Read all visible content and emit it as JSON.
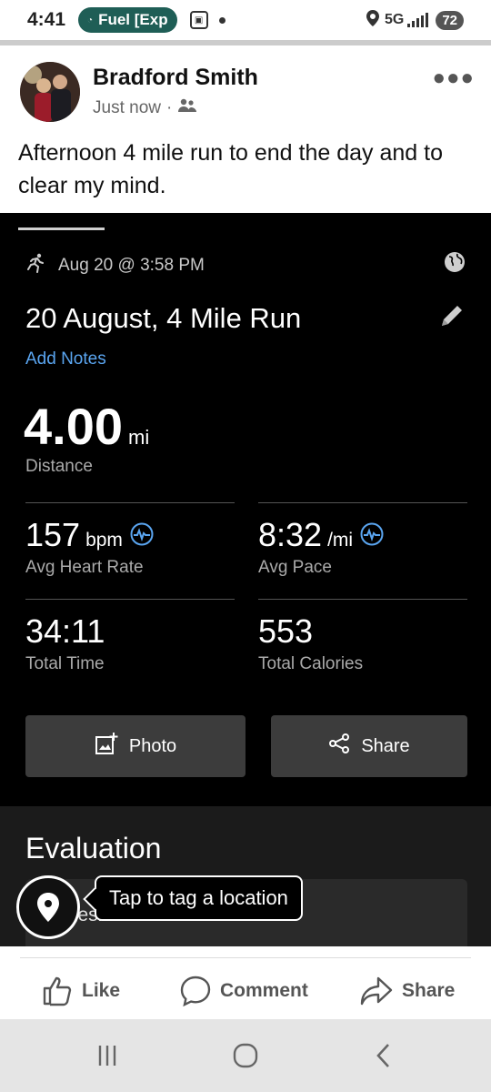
{
  "status_bar": {
    "time": "4:41",
    "pill_text": "Fuel [Exp",
    "network": "5G",
    "battery": "72"
  },
  "post": {
    "author": "Bradford Smith",
    "timestamp": "Just now",
    "text": "Afternoon 4 mile run to end the day and to clear my mind."
  },
  "activity": {
    "date": "Aug 20 @ 3:58 PM",
    "title": "20 August, 4 Mile Run",
    "add_notes": "Add Notes",
    "distance_value": "4.00",
    "distance_unit": "mi",
    "distance_label": "Distance",
    "stats": [
      {
        "value": "157",
        "unit": "bpm",
        "label": "Avg Heart Rate"
      },
      {
        "value": "8:32",
        "unit": "/mi",
        "label": "Avg Pace"
      },
      {
        "value": "34:11",
        "unit": "",
        "label": "Total Time"
      },
      {
        "value": "553",
        "unit": "",
        "label": "Total Calories"
      }
    ],
    "photo_label": "Photo",
    "share_label": "Share",
    "evaluation_title": "Evaluation",
    "threshold_label": "Threshold",
    "location_tip": "Tap to tag a location",
    "accent_color": "#5aa5f0"
  },
  "actions": {
    "like": "Like",
    "comment": "Comment",
    "share": "Share"
  }
}
